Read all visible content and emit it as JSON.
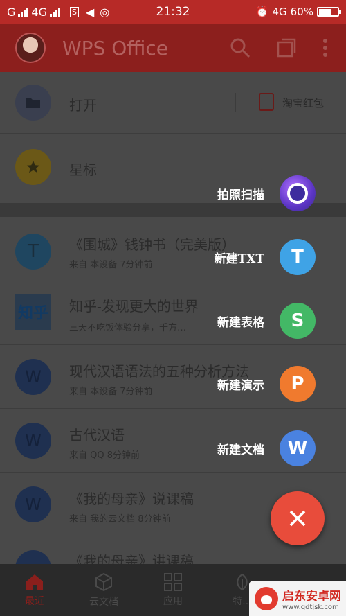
{
  "status": {
    "carrier1": "G",
    "carrier2": "4G",
    "time": "21:32",
    "network": "4G",
    "battery": "60%"
  },
  "app_bar": {
    "title": "WPS Office",
    "icons": [
      "search-icon",
      "multi-window-icon",
      "more-icon"
    ]
  },
  "list": {
    "open": {
      "label": "打开",
      "promo": "淘宝红包"
    },
    "star": {
      "label": "星标"
    },
    "files": [
      {
        "title": "《围城》钱钟书（完美版）",
        "sub": "来自 本设备   7分钟前",
        "icon": "T",
        "color": "#1f6f94"
      },
      {
        "title": "知乎-发现更大的世界",
        "sub": "三天不吃饭体验分享，千方…",
        "icon": "知乎",
        "color": "#1f4f7a"
      },
      {
        "title": "现代汉语语法的五种分析方法",
        "sub": "来自 本设备   7分钟前",
        "icon": "W",
        "color": "#1f437c"
      },
      {
        "title": "古代汉语",
        "sub": "来自 QQ   8分钟前",
        "icon": "W",
        "color": "#1f437c"
      },
      {
        "title": "《我的母亲》说课稿",
        "sub": "来自 我的云文档   8分钟前",
        "icon": "W",
        "color": "#1f437c"
      },
      {
        "title": "《我的母亲》讲课稿",
        "sub": "",
        "icon": "W",
        "color": "#1f437c"
      }
    ]
  },
  "fab_menu": [
    {
      "label": "拍照扫描",
      "glyph": "",
      "color": "#6b3fc0"
    },
    {
      "label": "新建TXT",
      "glyph": "T",
      "color": "#3fa3e6"
    },
    {
      "label": "新建表格",
      "glyph": "S",
      "color": "#43b866"
    },
    {
      "label": "新建演示",
      "glyph": "P",
      "color": "#f07a2e"
    },
    {
      "label": "新建文档",
      "glyph": "W",
      "color": "#4a82e0"
    }
  ],
  "bottom_nav": [
    {
      "label": "最近",
      "icon": "home-icon",
      "active": true
    },
    {
      "label": "云文档",
      "icon": "cube-icon",
      "active": false
    },
    {
      "label": "应用",
      "icon": "grid-icon",
      "active": false
    },
    {
      "label": "特...",
      "icon": "leaf-icon",
      "active": false
    },
    {
      "label": "",
      "icon": "user-icon",
      "active": false
    }
  ],
  "watermark": {
    "name": "启东安卓网",
    "url": "www.qdtjsk.com"
  }
}
